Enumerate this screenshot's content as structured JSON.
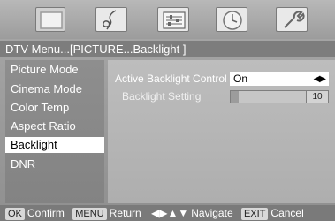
{
  "tabs": [
    {
      "icon": "tv-icon"
    },
    {
      "icon": "music-note-icon"
    },
    {
      "icon": "picture-settings-icon"
    },
    {
      "icon": "clock-icon"
    },
    {
      "icon": "wrench-icon"
    }
  ],
  "breadcrumb": "DTV Menu...[PICTURE...Backlight ]",
  "sidebar": {
    "items": [
      {
        "label": "Picture Mode"
      },
      {
        "label": "Cinema Mode"
      },
      {
        "label": "Color Temp"
      },
      {
        "label": "Aspect Ratio"
      },
      {
        "label": "Backlight",
        "selected": true
      },
      {
        "label": "DNR"
      }
    ]
  },
  "content": {
    "active_backlight_label": "Active Backlight Control",
    "active_backlight_value": "On",
    "backlight_setting_label": "Backlight Setting",
    "backlight_setting_value": "10",
    "backlight_setting_fraction": 0.1
  },
  "footer": {
    "ok_key": "OK",
    "ok_text": "Confirm",
    "menu_key": "MENU",
    "menu_text": "Return",
    "nav_text": "Navigate",
    "exit_key": "EXIT",
    "exit_text": "Cancel"
  }
}
